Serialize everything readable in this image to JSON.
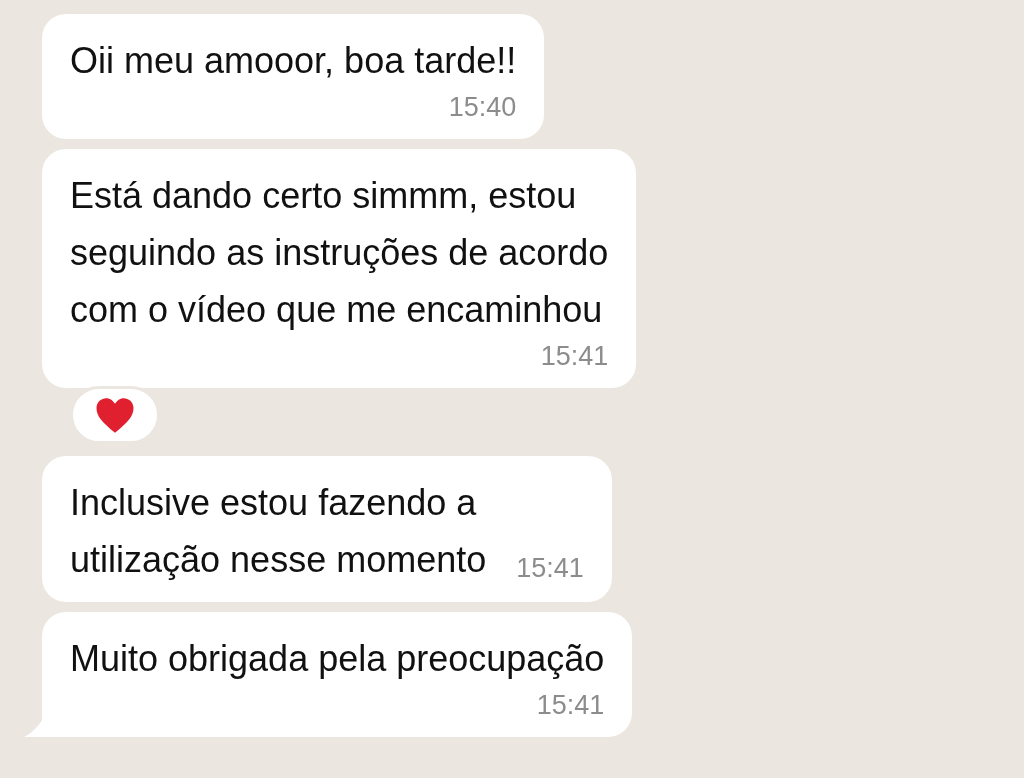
{
  "messages": [
    {
      "text": "Oii meu amooor, boa tarde!!",
      "time": "15:40",
      "kind": "stacked",
      "reaction": false,
      "tail": false
    },
    {
      "text": "Está dando certo simmm, estou\nseguindo as instruções de acordo\ncom o vídeo que me encaminhou",
      "time": "15:41",
      "kind": "stacked",
      "reaction": true,
      "tail": false
    },
    {
      "text": "Inclusive estou fazendo a\nutilização nesse momento",
      "time": "15:41",
      "kind": "inline",
      "reaction": false,
      "tail": false
    },
    {
      "text": "Muito obrigada pela preocupação",
      "time": "15:41",
      "kind": "stacked",
      "reaction": false,
      "tail": true
    }
  ]
}
